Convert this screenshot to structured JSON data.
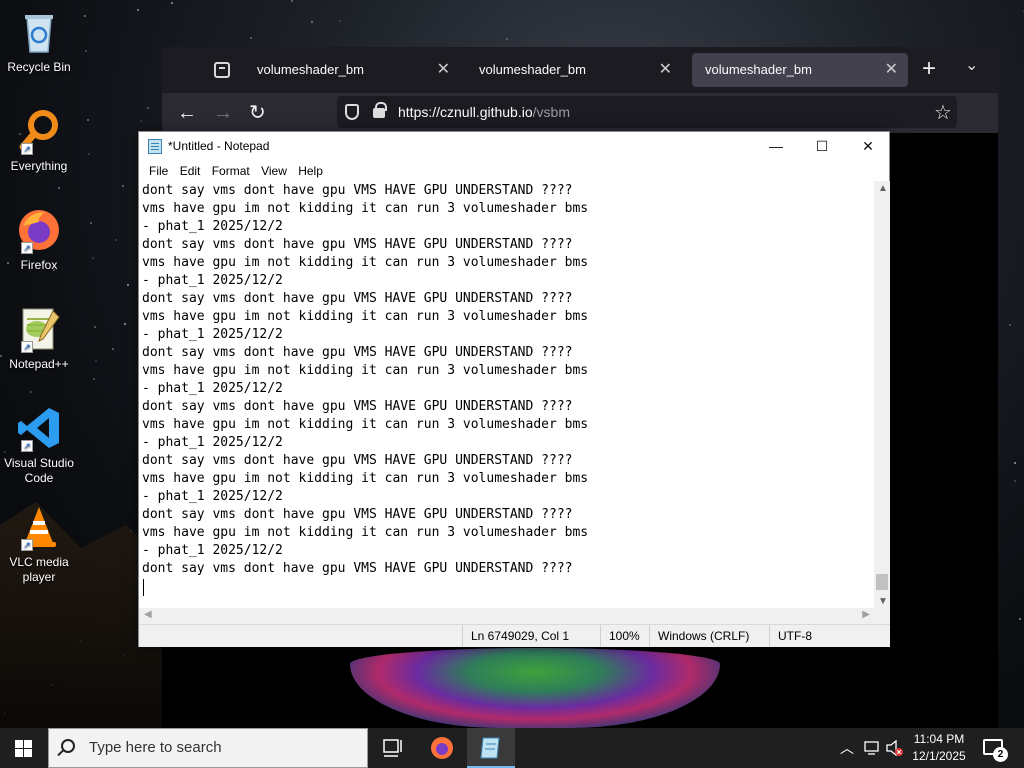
{
  "desktop": {
    "icons": [
      {
        "label": "Recycle Bin"
      },
      {
        "label": "Everything"
      },
      {
        "label": "Firefox"
      },
      {
        "label": "Notepad++"
      },
      {
        "label": "Visual Studio Code"
      },
      {
        "label": "VLC media player"
      }
    ]
  },
  "browser": {
    "tabs": [
      {
        "title": "volumeshader_bm"
      },
      {
        "title": "volumeshader_bm"
      },
      {
        "title": "volumeshader_bm"
      }
    ],
    "url_host": "https://cznull.github.io",
    "url_path": "/vsbm"
  },
  "notepad": {
    "title": "*Untitled - Notepad",
    "menu": [
      "File",
      "Edit",
      "Format",
      "View",
      "Help"
    ],
    "content": "dont say vms dont have gpu VMS HAVE GPU UNDERSTAND ????\nvms have gpu im not kidding it can run 3 volumeshader bms\n- phat_1 2025/12/2\ndont say vms dont have gpu VMS HAVE GPU UNDERSTAND ????\nvms have gpu im not kidding it can run 3 volumeshader bms\n- phat_1 2025/12/2\ndont say vms dont have gpu VMS HAVE GPU UNDERSTAND ????\nvms have gpu im not kidding it can run 3 volumeshader bms\n- phat_1 2025/12/2\ndont say vms dont have gpu VMS HAVE GPU UNDERSTAND ????\nvms have gpu im not kidding it can run 3 volumeshader bms\n- phat_1 2025/12/2\ndont say vms dont have gpu VMS HAVE GPU UNDERSTAND ????\nvms have gpu im not kidding it can run 3 volumeshader bms\n- phat_1 2025/12/2\ndont say vms dont have gpu VMS HAVE GPU UNDERSTAND ????\nvms have gpu im not kidding it can run 3 volumeshader bms\n- phat_1 2025/12/2\ndont say vms dont have gpu VMS HAVE GPU UNDERSTAND ????\nvms have gpu im not kidding it can run 3 volumeshader bms\n- phat_1 2025/12/2\ndont say vms dont have gpu VMS HAVE GPU UNDERSTAND ????",
    "status": {
      "position": "Ln 6749029, Col 1",
      "zoom": "100%",
      "line_ending": "Windows (CRLF)",
      "encoding": "UTF-8"
    }
  },
  "taskbar": {
    "search_placeholder": "Type here to search",
    "time": "11:04 PM",
    "date": "12/1/2025",
    "notification_count": "2"
  }
}
